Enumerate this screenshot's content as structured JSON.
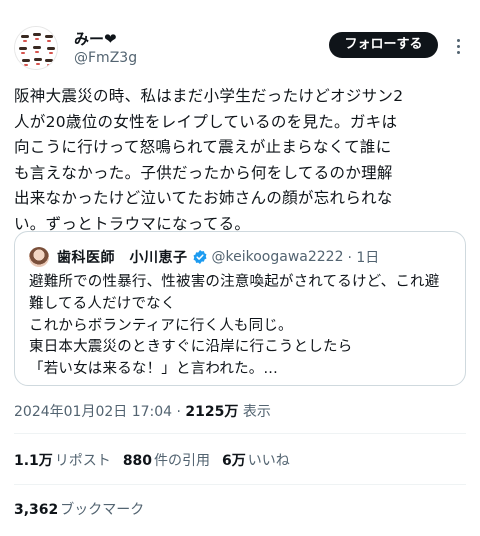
{
  "author": {
    "display_name": "みー❤",
    "handle": "@FmZ3g"
  },
  "follow_button_label": "フォローする",
  "tweet": {
    "lines": [
      "阪神大震災の時、私はまだ小学生だったけどオジサン2",
      "人が20歳位の女性をレイプしているのを見た。ガキは",
      "向こうに行けって怒鳴られて震えが止まらなくて誰に",
      "も言えなかった。子供だったから何をしてるのか理解",
      "出来なかったけど泣いてたお姉さんの顔が忘れられな",
      "い。ずっとトラウマになってる。"
    ]
  },
  "quote": {
    "name": "歯科医師　小川恵子",
    "handle": "@keikoogawa2222",
    "time": "· 1日",
    "lines": [
      "避難所での性暴行、性被害の注意喚起がされてるけど、これ避",
      "難してる人だけでなく",
      "これからボランティアに行く人も同じ。",
      "東日本大震災のときすぐに沿岸に行こうとしたら",
      "「若い女は来るな！」と言われた。..."
    ]
  },
  "timestamp": {
    "datetime": "2024年01月02日 17:04",
    "separator": "·",
    "views": "2125万",
    "views_label": "表示"
  },
  "stats": {
    "reposts": {
      "count": "1.1万",
      "label": "リポスト"
    },
    "quotes": {
      "count": "880",
      "label": "件の引用"
    },
    "likes": {
      "count": "6万",
      "label": "いいね"
    }
  },
  "bookmarks": {
    "count": "3,362",
    "label": "ブックマーク"
  },
  "colors": {
    "text": "#0f1419",
    "secondary": "#536471",
    "border": "#cfd9de",
    "verified": "#1d9bf0",
    "button_bg": "#0f1419"
  },
  "icons": {
    "avatar": "avatar-faces-icon",
    "more": "more-dots-icon",
    "verified": "verified-badge-icon"
  }
}
